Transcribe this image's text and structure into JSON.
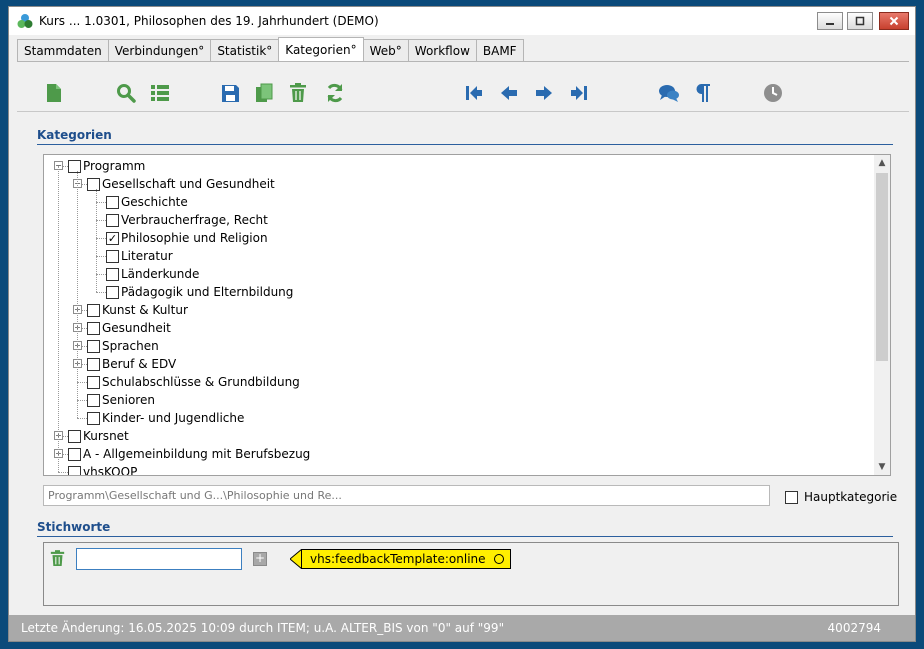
{
  "window": {
    "title": "Kurs ... 1.0301, Philosophen des 19. Jahrhundert (DEMO)"
  },
  "tabs": [
    {
      "label": "Stammdaten",
      "active": false
    },
    {
      "label": "Verbindungen°",
      "active": false
    },
    {
      "label": "Statistik°",
      "active": false
    },
    {
      "label": "Kategorien°",
      "active": true
    },
    {
      "label": "Web°",
      "active": false
    },
    {
      "label": "Workflow",
      "active": false
    },
    {
      "label": "BAMF",
      "active": false
    }
  ],
  "toolbar": {
    "icons": [
      "new-document-icon",
      "search-icon",
      "list-icon",
      "save-icon",
      "copy-icon",
      "delete-icon",
      "refresh-icon",
      "first-record-icon",
      "previous-record-icon",
      "next-record-icon",
      "last-record-icon",
      "comments-icon",
      "paragraph-icon",
      "history-clock-icon"
    ]
  },
  "categories": {
    "title": "Kategorien",
    "tree": [
      {
        "label": "Programm",
        "level": 0,
        "expander": "-",
        "checked": false
      },
      {
        "label": "Gesellschaft und Gesundheit",
        "level": 1,
        "expander": "-",
        "checked": false
      },
      {
        "label": "Geschichte",
        "level": 2,
        "expander": "",
        "checked": false
      },
      {
        "label": "Verbraucherfrage, Recht",
        "level": 2,
        "expander": "",
        "checked": false
      },
      {
        "label": "Philosophie und Religion",
        "level": 2,
        "expander": "",
        "checked": true
      },
      {
        "label": "Literatur",
        "level": 2,
        "expander": "",
        "checked": false
      },
      {
        "label": "Länderkunde",
        "level": 2,
        "expander": "",
        "checked": false
      },
      {
        "label": "Pädagogik und Elternbildung",
        "level": 2,
        "expander": "",
        "checked": false
      },
      {
        "label": "Kunst & Kultur",
        "level": 1,
        "expander": "+",
        "checked": false
      },
      {
        "label": "Gesundheit",
        "level": 1,
        "expander": "+",
        "checked": false
      },
      {
        "label": "Sprachen",
        "level": 1,
        "expander": "+",
        "checked": false
      },
      {
        "label": "Beruf & EDV",
        "level": 1,
        "expander": "+",
        "checked": false
      },
      {
        "label": "Schulabschlüsse & Grundbildung",
        "level": 1,
        "expander": "",
        "checked": false
      },
      {
        "label": "Senioren",
        "level": 1,
        "expander": "",
        "checked": false
      },
      {
        "label": "Kinder- und Jugendliche",
        "level": 1,
        "expander": "",
        "checked": false
      },
      {
        "label": "Kursnet",
        "level": 0,
        "expander": "+",
        "checked": false
      },
      {
        "label": "A - Allgemeinbildung mit Berufsbezug",
        "level": 0,
        "expander": "+",
        "checked": false
      },
      {
        "label": "vhsKOOP",
        "level": 0,
        "expander": "",
        "checked": false
      }
    ],
    "path_value": "Programm\\Gesellschaft und G...\\Philosophie und Re...",
    "main_category_label": "Hauptkategorie",
    "main_category_checked": false
  },
  "keywords": {
    "title": "Stichworte",
    "input_value": "",
    "tags": [
      "vhs:feedbackTemplate:online"
    ]
  },
  "status": {
    "left": "Letzte Änderung: 16.05.2025 10:09 durch ITEM; u.A. ALTER_BIS von \"0\" auf \"99\"",
    "right": "4002794"
  },
  "colors": {
    "accent": "#1e4e8c",
    "toolbar_green": "#4e9a4a",
    "toolbar_blue": "#2a6bb0",
    "tag_yellow": "#ffee00"
  }
}
